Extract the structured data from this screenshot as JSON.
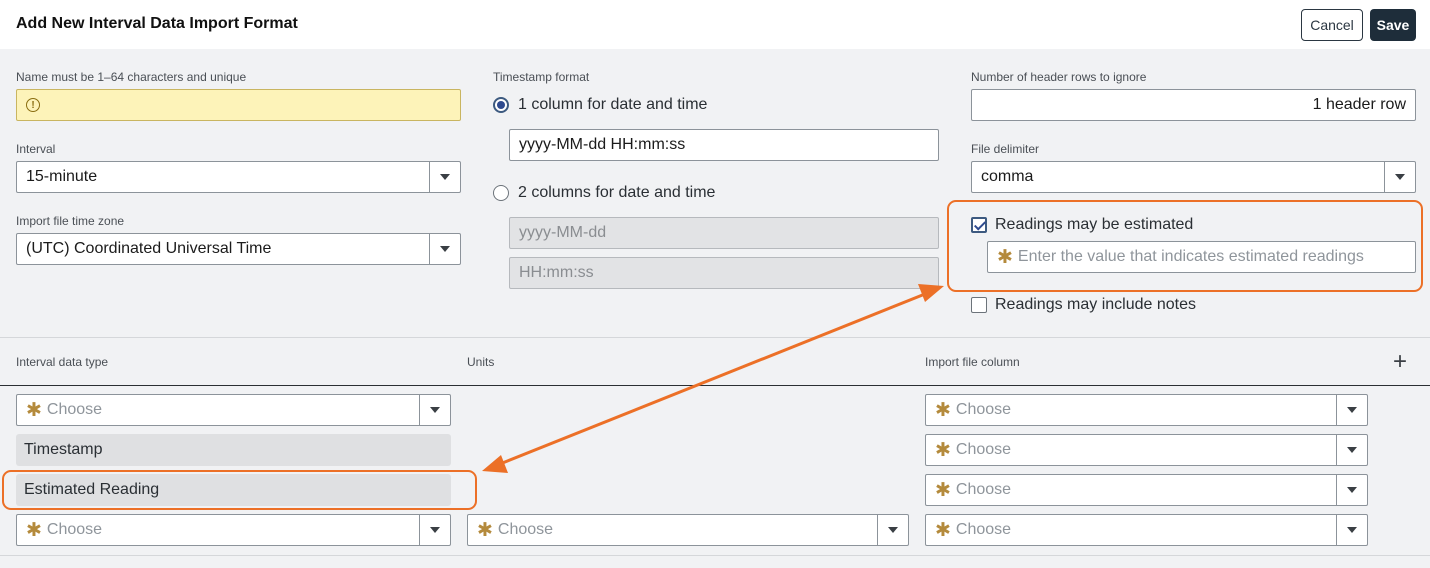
{
  "header": {
    "title": "Add New Interval Data Import Format",
    "cancel_label": "Cancel",
    "save_label": "Save"
  },
  "form": {
    "name_label": "Name must be 1–64 characters and unique",
    "name_value": "",
    "interval_label": "Interval",
    "interval_value": "15-minute",
    "timezone_label": "Import file time zone",
    "timezone_value": "(UTC) Coordinated Universal Time",
    "timestamp_label": "Timestamp format",
    "ts_option1": "1 column for date and time",
    "ts_option1_value": "yyyy-MM-dd HH:mm:ss",
    "ts_option2": "2 columns for date and time",
    "ts_option2_date": "yyyy-MM-dd",
    "ts_option2_time": "HH:mm:ss",
    "header_rows_label": "Number of header rows to ignore",
    "header_rows_value": "1 header row",
    "delimiter_label": "File delimiter",
    "delimiter_value": "comma",
    "estimated_label": "Readings may be estimated",
    "estimated_placeholder": "Enter the value that indicates estimated readings",
    "notes_label": "Readings may include notes"
  },
  "table": {
    "col_type": "Interval data type",
    "col_units": "Units",
    "col_column": "Import file column",
    "choose": "Choose",
    "row2_type": "Timestamp",
    "row3_type": "Estimated Reading"
  },
  "colors": {
    "accent": "#ec7027",
    "primary": "#1e2d3a",
    "warning_bg": "#fdf3b9"
  }
}
